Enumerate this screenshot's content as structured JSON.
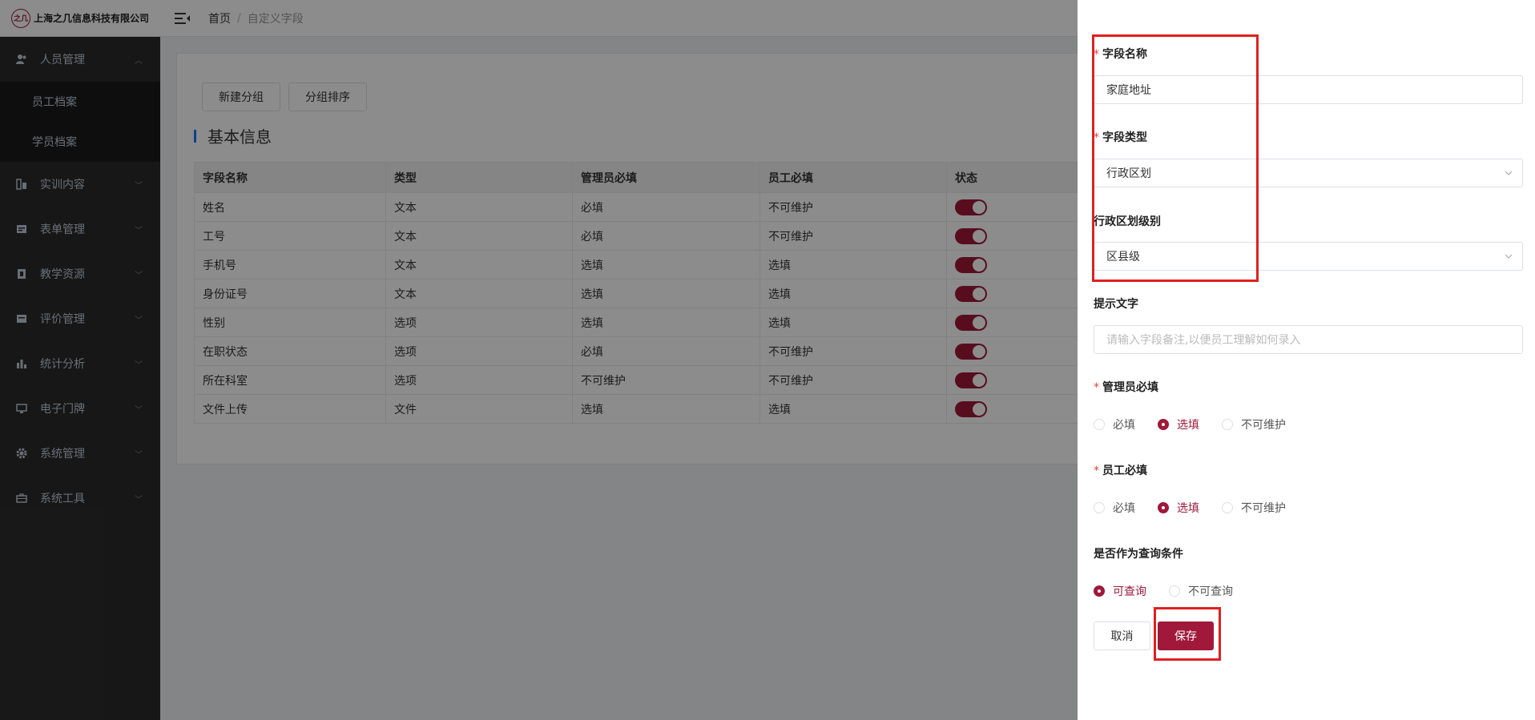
{
  "header": {
    "logo_mark": "之几",
    "company": "上海之几信息科技有限公司",
    "breadcrumb_home": "首页",
    "breadcrumb_sep": "/",
    "breadcrumb_current": "自定义字段"
  },
  "sidebar": {
    "items": [
      {
        "label": "人员管理",
        "icon": "people-icon",
        "expanded": true,
        "children": [
          "员工档案",
          "学员档案"
        ]
      },
      {
        "label": "实训内容",
        "icon": "training-icon"
      },
      {
        "label": "表单管理",
        "icon": "form-icon"
      },
      {
        "label": "教学资源",
        "icon": "resource-icon"
      },
      {
        "label": "评价管理",
        "icon": "evaluation-icon"
      },
      {
        "label": "统计分析",
        "icon": "bar-chart-icon"
      },
      {
        "label": "电子门牌",
        "icon": "monitor-icon"
      },
      {
        "label": "系统管理",
        "icon": "gear-icon"
      },
      {
        "label": "系统工具",
        "icon": "toolbox-icon"
      }
    ]
  },
  "main": {
    "btn_new_group": "新建分组",
    "btn_sort_group": "分组排序",
    "section_title": "基本信息",
    "table": {
      "headers": [
        "字段名称",
        "类型",
        "管理员必填",
        "员工必填",
        "状态"
      ],
      "rows": [
        [
          "姓名",
          "文本",
          "必填",
          "不可维护"
        ],
        [
          "工号",
          "文本",
          "必填",
          "不可维护"
        ],
        [
          "手机号",
          "文本",
          "选填",
          "选填"
        ],
        [
          "身份证号",
          "文本",
          "选填",
          "选填"
        ],
        [
          "性别",
          "选项",
          "选填",
          "选填"
        ],
        [
          "在职状态",
          "选项",
          "必填",
          "不可维护"
        ],
        [
          "所在科室",
          "选项",
          "不可维护",
          "不可维护"
        ],
        [
          "文件上传",
          "文件",
          "选填",
          "选填"
        ]
      ],
      "status_on": true
    }
  },
  "drawer": {
    "field_name_label": "字段名称",
    "field_name_value": "家庭地址",
    "field_type_label": "字段类型",
    "field_type_value": "行政区划",
    "region_level_label": "行政区划级别",
    "region_level_value": "区县级",
    "hint_label": "提示文字",
    "hint_placeholder": "请输入字段备注,以便员工理解如何录入",
    "admin_required_label": "管理员必填",
    "admin_required_options": [
      "必填",
      "选填",
      "不可维护"
    ],
    "admin_required_selected": "选填",
    "staff_required_label": "员工必填",
    "staff_required_options": [
      "必填",
      "选填",
      "不可维护"
    ],
    "staff_required_selected": "选填",
    "query_label": "是否作为查询条件",
    "query_options": [
      "可查询",
      "不可查询"
    ],
    "query_selected": "可查询",
    "required_mark": "*",
    "cancel": "取消",
    "save": "保存"
  },
  "colors": {
    "primary": "#a0193a",
    "sidebar_bg": "#2b2b2b",
    "highlight": "#e02020",
    "section_bar": "#1677ff"
  }
}
